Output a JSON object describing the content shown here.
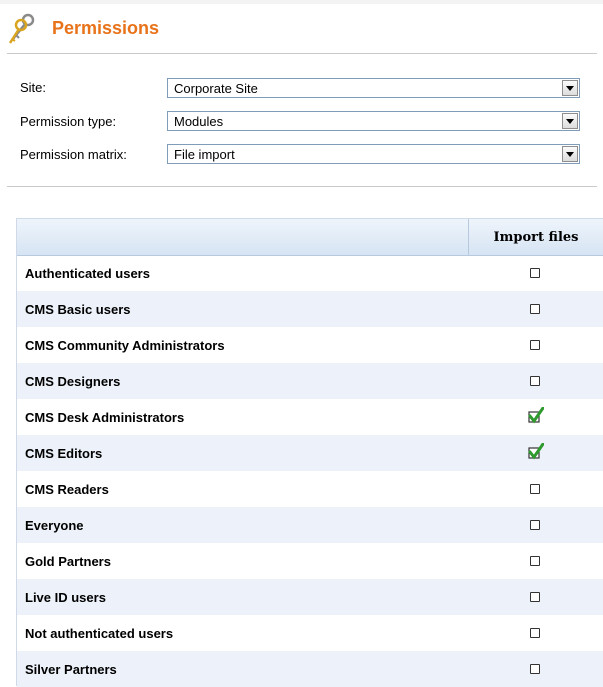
{
  "header": {
    "title": "Permissions",
    "icon": "keys-icon",
    "title_color": "#e8731a"
  },
  "filters": {
    "site": {
      "label": "Site:",
      "value": "Corporate Site"
    },
    "permission_type": {
      "label": "Permission type:",
      "value": "Modules"
    },
    "permission_matrix": {
      "label": "Permission matrix:",
      "value": "File import"
    }
  },
  "grid": {
    "column": "Import files",
    "rows": [
      {
        "role": "Authenticated users",
        "checked": false
      },
      {
        "role": "CMS Basic users",
        "checked": false
      },
      {
        "role": "CMS Community Administrators",
        "checked": false
      },
      {
        "role": "CMS Designers",
        "checked": false
      },
      {
        "role": "CMS Desk Administrators",
        "checked": true
      },
      {
        "role": "CMS Editors",
        "checked": true
      },
      {
        "role": "CMS Readers",
        "checked": false
      },
      {
        "role": "Everyone",
        "checked": false
      },
      {
        "role": "Gold Partners",
        "checked": false
      },
      {
        "role": "Live ID users",
        "checked": false
      },
      {
        "role": "Not authenticated users",
        "checked": false
      },
      {
        "role": "Silver Partners",
        "checked": false
      }
    ]
  }
}
